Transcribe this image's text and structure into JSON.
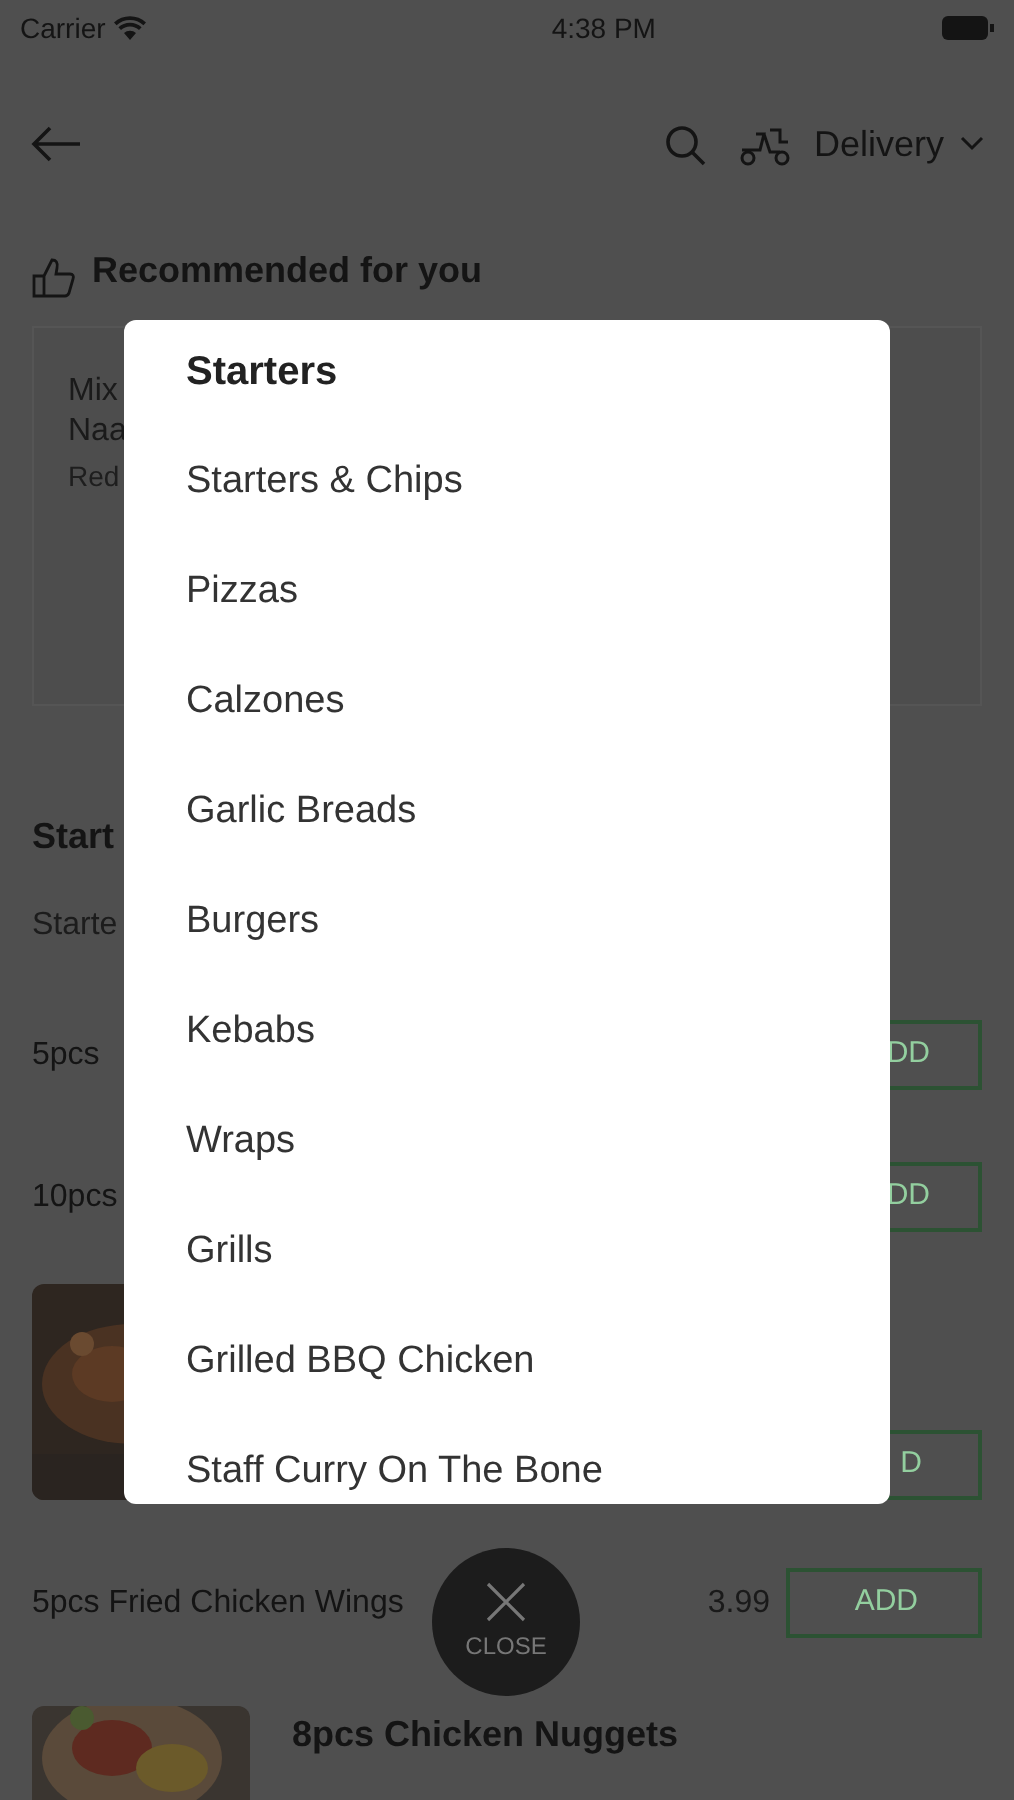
{
  "status_bar": {
    "carrier": "Carrier",
    "time": "4:38 PM"
  },
  "header": {
    "mode": "Delivery"
  },
  "recommended": {
    "title": "Recommended for you",
    "card_lines": [
      "Mix",
      "Naa"
    ],
    "card_note": "Red"
  },
  "section": {
    "title": "Start",
    "subtitle": "Starte"
  },
  "rows": [
    {
      "kind": "text",
      "name": "5pcs",
      "button": "DD"
    },
    {
      "kind": "text",
      "name": "10pcs",
      "button": "DD"
    },
    {
      "button": "D"
    },
    {
      "kind": "text",
      "name": "5pcs Fried Chicken Wings",
      "price": "3.99",
      "button": "ADD"
    },
    {
      "name": "8pcs Chicken Nuggets"
    }
  ],
  "menu": {
    "title": "Starters",
    "items": [
      "Starters & Chips",
      "Pizzas",
      "Calzones",
      "Garlic Breads",
      "Burgers",
      "Kebabs",
      "Wraps",
      "Grills",
      "Grilled BBQ Chicken",
      "Staff Curry On The Bone"
    ]
  },
  "close": {
    "label": "CLOSE"
  }
}
